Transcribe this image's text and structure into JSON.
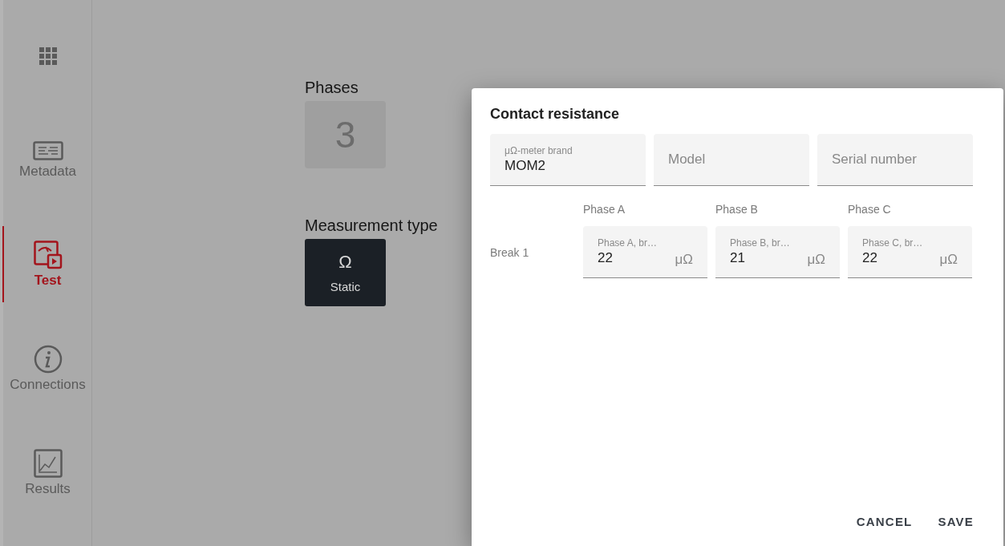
{
  "sidebar": {
    "items": [
      {
        "kind": "apps",
        "selected": false
      },
      {
        "kind": "metadata",
        "label": "Metadata",
        "selected": false
      },
      {
        "kind": "test",
        "label": "Test",
        "selected": true
      },
      {
        "kind": "connections",
        "label": "Connections",
        "selected": false
      },
      {
        "kind": "results",
        "label": "Results",
        "selected": false
      }
    ]
  },
  "main": {
    "phases": {
      "label": "Phases",
      "value": "3"
    },
    "measurement_type": {
      "label": "Measurement type",
      "options": [
        {
          "symbol": "Ω",
          "label": "Static",
          "selected": true
        }
      ]
    }
  },
  "dialog": {
    "title": "Contact resistance",
    "fields": [
      {
        "label": "μΩ-meter brand",
        "value": "MOM2"
      },
      {
        "placeholder": "Model"
      },
      {
        "placeholder": "Serial number"
      }
    ],
    "columns": [
      "Phase A",
      "Phase B",
      "Phase C"
    ],
    "rows": [
      {
        "label": "Break 1",
        "cells": [
          {
            "label": "Phase A, br…",
            "value": "22",
            "unit": "μΩ"
          },
          {
            "label": "Phase B, br…",
            "value": "21",
            "unit": "μΩ"
          },
          {
            "label": "Phase C, br…",
            "value": "22",
            "unit": "μΩ"
          }
        ]
      }
    ],
    "buttons": [
      "CANCEL",
      "SAVE"
    ]
  }
}
